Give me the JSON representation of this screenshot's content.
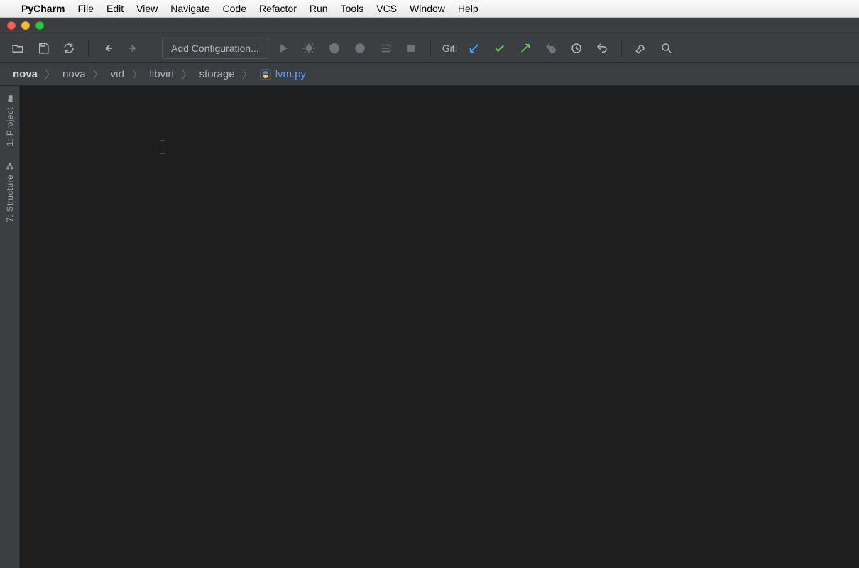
{
  "mac_menu": {
    "app_name": "PyCharm",
    "items": [
      "File",
      "Edit",
      "View",
      "Navigate",
      "Code",
      "Refactor",
      "Run",
      "Tools",
      "VCS",
      "Window",
      "Help"
    ]
  },
  "toolbar": {
    "add_configuration_label": "Add Configuration...",
    "git_label": "Git:"
  },
  "breadcrumb": {
    "items": [
      "nova",
      "nova",
      "virt",
      "libvirt",
      "storage"
    ],
    "file": "lvm.py"
  },
  "side_tabs": {
    "project": "1: Project",
    "structure": "7: Structure"
  },
  "icons": {
    "open": "open-folder-icon",
    "save": "save-all-icon",
    "sync": "sync-icon",
    "back": "back-arrow-icon",
    "forward": "forward-arrow-icon",
    "run": "run-icon",
    "debug": "debug-icon",
    "coverage": "coverage-icon",
    "profile": "profile-icon",
    "concurrency": "concurrency-icon",
    "stop": "stop-icon",
    "git_update": "git-update-icon",
    "git_commit": "git-commit-icon",
    "git_push": "git-push-icon",
    "git_rollback": "git-rollback-icon",
    "git_history": "git-history-icon",
    "undo": "undo-icon",
    "settings": "settings-wrench-icon",
    "search": "search-icon"
  }
}
